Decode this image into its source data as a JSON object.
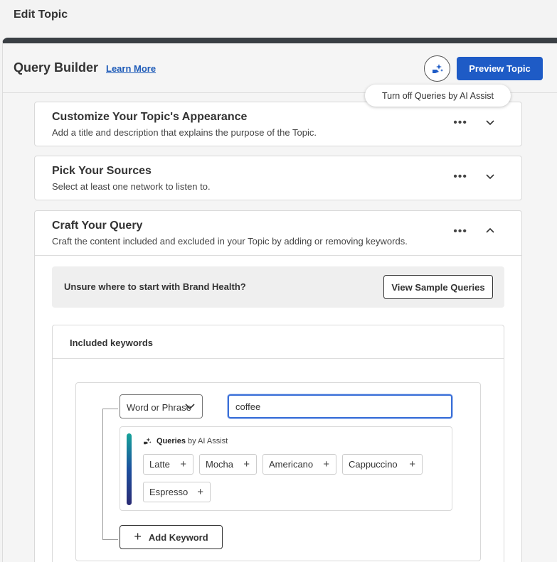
{
  "page": {
    "title": "Edit Topic"
  },
  "query_builder": {
    "title": "Query Builder",
    "learn_more": "Learn More",
    "preview_button": "Preview Topic",
    "tooltip": "Turn off Queries by AI Assist"
  },
  "sections": [
    {
      "title": "Customize Your Topic's Appearance",
      "description": "Add a title and description that explains the purpose of the Topic.",
      "more": "•••",
      "state": "collapsed"
    },
    {
      "title": "Pick Your Sources",
      "description": "Select at least one network to listen to.",
      "more": "•••",
      "state": "collapsed"
    },
    {
      "title": "Craft Your Query",
      "description": "Craft the content included and excluded in your Topic by adding or removing keywords.",
      "more": "•••",
      "state": "expanded"
    }
  ],
  "sample": {
    "prompt": "Unsure where to start with Brand Health?",
    "button": "View Sample Queries"
  },
  "included": {
    "title": "Included keywords",
    "match_type": "Word or Phrase",
    "keyword_value": "coffee",
    "ai_assist": {
      "label_strong": "Queries",
      "label_rest": "by AI Assist",
      "suggestions": [
        "Latte",
        "Mocha",
        "Americano",
        "Cappuccino",
        "Espresso"
      ]
    },
    "add_button": "Add Keyword"
  },
  "colors": {
    "primary": "#1e5bc6",
    "focus": "#3a6fd8",
    "header_bar": "#3a3f44"
  }
}
